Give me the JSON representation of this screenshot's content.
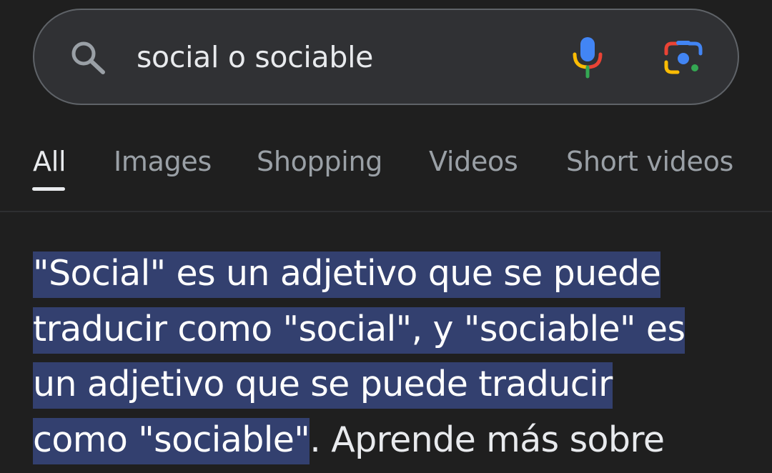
{
  "search": {
    "query": "social o sociable",
    "icons": {
      "search": "search-icon",
      "voice": "mic-icon",
      "lens": "google-lens-icon"
    }
  },
  "tabs": [
    {
      "label": "All",
      "active": true
    },
    {
      "label": "Images",
      "active": false
    },
    {
      "label": "Shopping",
      "active": false
    },
    {
      "label": "Videos",
      "active": false
    },
    {
      "label": "Short videos",
      "active": false
    }
  ],
  "answer": {
    "line1_highlight": "\"Social\" es un adjetivo que se puede",
    "line2_highlight": "traducir como \"social\", y \"sociable\" es",
    "line3_highlight": "un adjetivo que se puede traducir",
    "line4_highlight": "como \"sociable\"",
    "line4_rest": ". Aprende más sobre"
  },
  "colors": {
    "background": "#1f1f1f",
    "search_bar": "#303134",
    "highlight": "#33406f",
    "text_primary": "#e8eaed",
    "text_secondary": "#9aa0a6"
  }
}
